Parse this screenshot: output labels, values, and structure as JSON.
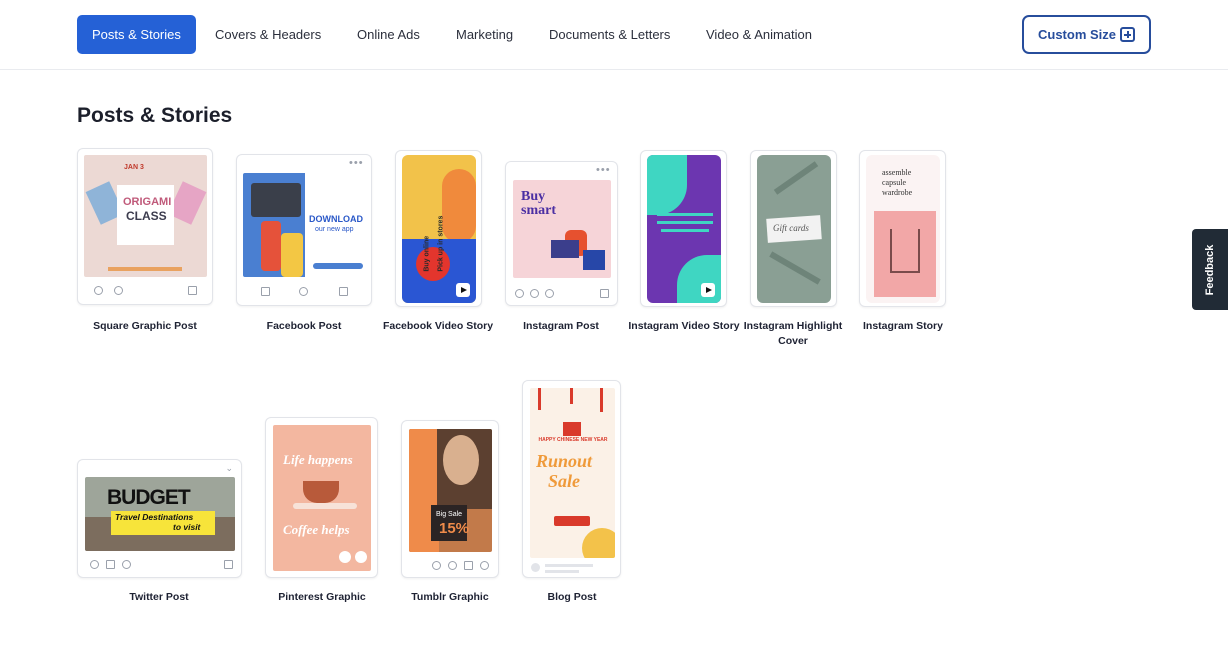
{
  "nav": {
    "tabs": [
      {
        "label": "Posts & Stories",
        "active": true
      },
      {
        "label": "Covers & Headers"
      },
      {
        "label": "Online Ads"
      },
      {
        "label": "Marketing"
      },
      {
        "label": "Documents & Letters"
      },
      {
        "label": "Video & Animation"
      }
    ],
    "custom_size_label": "Custom Size"
  },
  "section": {
    "title": "Posts & Stories"
  },
  "templates": [
    {
      "label": "Square Graphic Post",
      "art": {
        "line1": "JAN 3",
        "line2": "ORIGAMI",
        "line3": "CLASS"
      }
    },
    {
      "label": "Facebook Post",
      "art": {
        "line1": "DOWNLOAD",
        "line2": "our new app"
      }
    },
    {
      "label": "Facebook Video Story",
      "art": {
        "line1": "Buy online",
        "line2": "Pick up in stores"
      }
    },
    {
      "label": "Instagram Post",
      "art": {
        "line1": "Buy",
        "line2": "smart"
      }
    },
    {
      "label": "Instagram Video Story",
      "art": {}
    },
    {
      "label": "Instagram Highlight Cover",
      "art": {
        "line1": "Gift cards"
      }
    },
    {
      "label": "Instagram Story",
      "art": {
        "line1": "assemble",
        "line2": "capsule",
        "line3": "wardrobe"
      }
    },
    {
      "label": "Twitter Post",
      "art": {
        "line1": "BUDGET",
        "line2": "Travel Destinations",
        "line3": "to visit"
      }
    },
    {
      "label": "Pinterest Graphic",
      "art": {
        "line1": "Life happens",
        "line2": "Coffee helps"
      }
    },
    {
      "label": "Tumblr Graphic",
      "art": {
        "line1": "Big Sale",
        "line2": "15%"
      }
    },
    {
      "label": "Blog Post",
      "art": {
        "line1": "HAPPY CHINESE NEW YEAR",
        "line2": "Runout",
        "line3": "Sale"
      }
    }
  ],
  "feedback_label": "Feedback",
  "colors": {
    "accent": "#2561d6",
    "custom_border": "#274d9c",
    "feedback_bg": "#212b36"
  }
}
